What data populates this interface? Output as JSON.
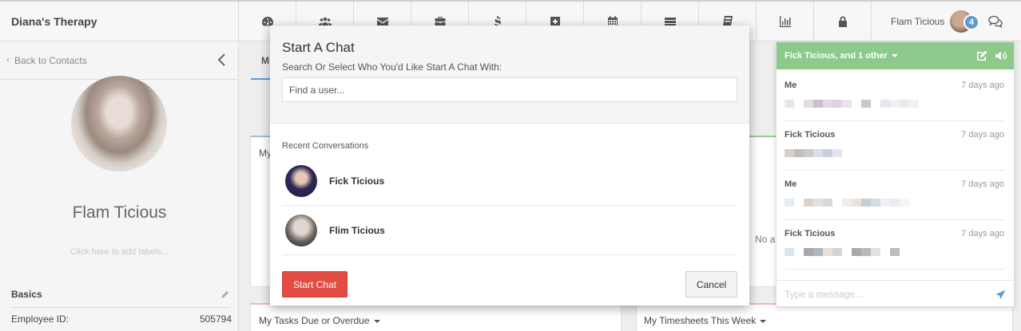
{
  "app": {
    "title": "Diana's Therapy"
  },
  "nav": {
    "icons": [
      "dashboard-icon",
      "users-icon",
      "envelope-icon",
      "briefcase-icon",
      "dollar-icon",
      "plus-square-icon",
      "calendar-icon",
      "server-icon",
      "book-icon",
      "bar-chart-icon",
      "lock-icon"
    ]
  },
  "user": {
    "name": "Flam Ticious",
    "notification_count": "4"
  },
  "left": {
    "back_label": "Back to Contacts",
    "profile_name": "Flam Ticious",
    "labels_hint": "Click here to add labels...",
    "basics_title": "Basics",
    "employee_id_label": "Employee ID:",
    "employee_id_value": "505794"
  },
  "main": {
    "tab_label": "M",
    "card1_label": "My",
    "card2_label": "No a",
    "card3_label": "My Tasks Due or Overdue",
    "card4_label": "My Timesheets This Week"
  },
  "modal": {
    "title": "Start A Chat",
    "subtitle": "Search Or Select Who You'd Like Start A Chat With:",
    "search_placeholder": "Find a user...",
    "recent_title": "Recent Conversations",
    "conversations": [
      {
        "name": "Fick Ticious"
      },
      {
        "name": "Flim Ticious"
      }
    ],
    "start_label": "Start Chat",
    "cancel_label": "Cancel"
  },
  "chat": {
    "header": "Fick Ticious, and 1 other",
    "messages": [
      {
        "sender": "Me",
        "time": "7 days ago"
      },
      {
        "sender": "Fick Ticious",
        "time": "7 days ago"
      },
      {
        "sender": "Me",
        "time": "7 days ago"
      },
      {
        "sender": "Fick Ticious",
        "time": "7 days ago"
      }
    ],
    "input_placeholder": "Type a message..."
  },
  "colors": {
    "accent_blue": "#5b9bd5",
    "chat_header_green": "#8cc98a",
    "start_button_red": "#e24c42"
  }
}
